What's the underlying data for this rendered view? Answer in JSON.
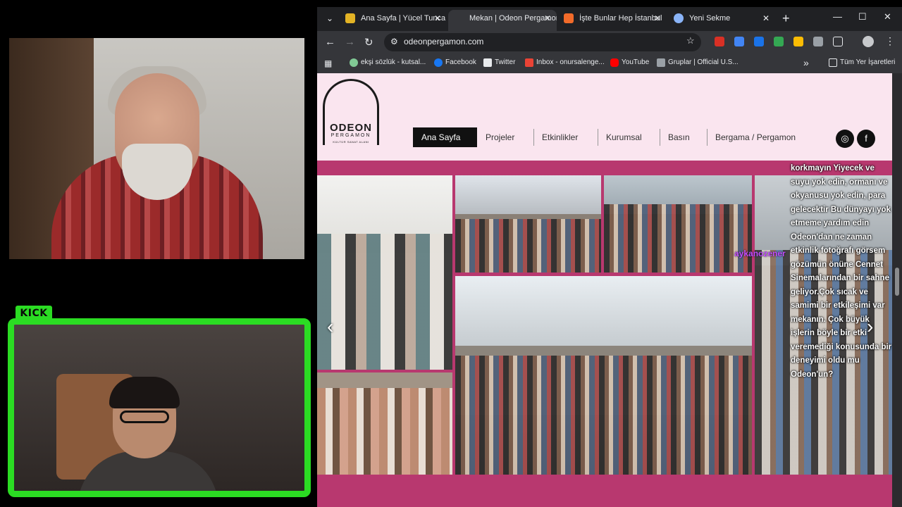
{
  "kick_label": "KICK",
  "browser": {
    "tabs": [
      {
        "title": "Ana Sayfa | Yücel Tunca",
        "active": false,
        "favicon_color": "#e3b325"
      },
      {
        "title": "Mekan | Odeon Pergamon",
        "active": true,
        "favicon_color": ""
      },
      {
        "title": "İşte Bunlar Hep İstanbul",
        "active": false,
        "favicon_color": "#f26b2a"
      },
      {
        "title": "Yeni Sekme",
        "active": false,
        "favicon_color": "#8ab4f8"
      }
    ],
    "close_glyph": "✕",
    "newtab_glyph": "+",
    "window_controls": [
      "—",
      "☐",
      "✕"
    ],
    "url": "odeonpergamon.com",
    "bookmarks": [
      {
        "label": "ekşi sözlük - kutsal...",
        "color": "#81c995"
      },
      {
        "label": "Facebook",
        "color": "#1877f2"
      },
      {
        "label": "Twitter",
        "color": "#e8eaed"
      },
      {
        "label": "Inbox - onursalenge...",
        "color": "#ea4335"
      },
      {
        "label": "YouTube",
        "color": "#ff0000"
      },
      {
        "label": "Gruplar | Official U.S...",
        "color": "#9aa0a6"
      }
    ],
    "all_bookmarks": "Tüm Yer İşaretleri",
    "extensions_colors": [
      "#d93025",
      "#4285f4",
      "#1a73e8",
      "#34a853",
      "#fbbc04",
      "#9aa0a6",
      "#e8eaed"
    ]
  },
  "site": {
    "logo": {
      "line1": "ODEON",
      "line2": "PERGAMON",
      "line3": "KÜLTÜR SANAT ALANI"
    },
    "nav": [
      "Ana Sayfa",
      "Projeler",
      "Etkinlikler",
      "Kurumsal",
      "Basın",
      "Bergama / Pergamon"
    ],
    "social": [
      "instagram-icon",
      "facebook-icon"
    ],
    "social_glyphs": [
      "◎",
      "f"
    ],
    "accent_bg": "#b8386f",
    "header_bg": "#fae5ef"
  },
  "chat_overlay": {
    "username": "aykanozener",
    "message": "korkmayın Yiyecek ve suyu yok edin, ormanı ve okyanusu yok edin, para gelecektir Bu dünyayı yok etmeme yardım edin Odeon'dan ne zaman etkinlik fotoğrafı görsem gözümün önüne Cennet Sinemalarından bir sahne geliyor.Çok sıcak ve samimi bir etkileşimi var mekanın. Çok büyük işlerin böyle bir etki veremediği konusunda bir deneyimi oldu mu Odeon'un?"
  }
}
